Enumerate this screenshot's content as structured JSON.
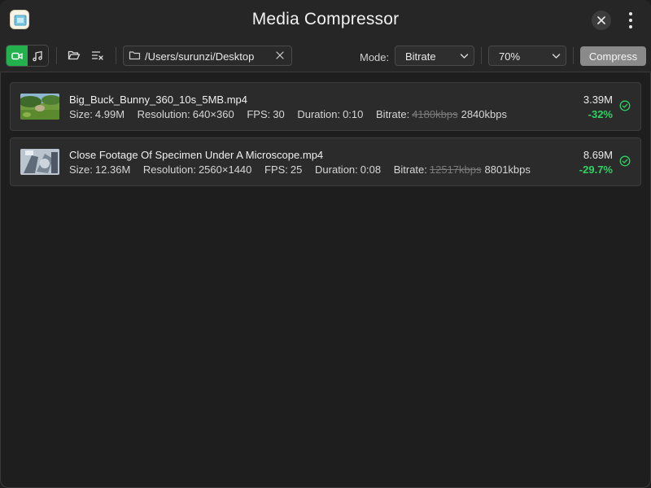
{
  "window": {
    "title": "Media Compressor",
    "icons": {
      "app": "app-icon",
      "close": "close-icon",
      "more": "more-vertical-icon"
    }
  },
  "toolbar": {
    "media_types": [
      {
        "icon": "video-icon",
        "active": true
      },
      {
        "icon": "music-icon",
        "active": false
      }
    ],
    "open_icon": "folder-open-icon",
    "clear_list_icon": "clear-list-icon",
    "output_path": "/Users/surunzi/Desktop",
    "mode_label": "Mode:",
    "mode_value": "Bitrate",
    "quality_value": "70%",
    "compress_label": "Compress",
    "accent_color": "#22b14c"
  },
  "files": [
    {
      "name": "Big_Buck_Bunny_360_10s_5MB.mp4",
      "size_label": "Size:",
      "size": "4.99M",
      "resolution_label": "Resolution:",
      "resolution": "640×360",
      "fps_label": "FPS:",
      "fps": "30",
      "duration_label": "Duration:",
      "duration": "0:10",
      "bitrate_label": "Bitrate:",
      "bitrate_old": "4180kbps",
      "bitrate_new": "2840kbps",
      "new_size": "3.39M",
      "change": "-32%",
      "status_icon": "check-circle-icon"
    },
    {
      "name": "Close Footage Of Specimen Under A Microscope.mp4",
      "size_label": "Size:",
      "size": "12.36M",
      "resolution_label": "Resolution:",
      "resolution": "2560×1440",
      "fps_label": "FPS:",
      "fps": "25",
      "duration_label": "Duration:",
      "duration": "0:08",
      "bitrate_label": "Bitrate:",
      "bitrate_old": "12517kbps",
      "bitrate_new": "8801kbps",
      "new_size": "8.69M",
      "change": "-29.7%",
      "status_icon": "check-circle-icon"
    }
  ]
}
